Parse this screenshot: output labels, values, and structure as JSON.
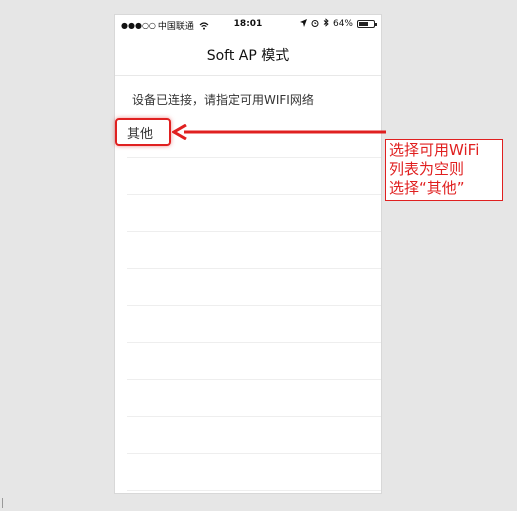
{
  "status_bar": {
    "signal_dots": "●●●○○",
    "carrier": "中国联通",
    "time": "18:01",
    "battery_percent": "64%",
    "battery_level": 0.64
  },
  "navbar": {
    "title": "Soft AP 模式"
  },
  "instruction": "设备已连接，请指定可用WIFI网络",
  "wifi_list": {
    "items": [
      "其他",
      "",
      "",
      "",
      "",
      "",
      "",
      "",
      "",
      ""
    ]
  },
  "annotation": {
    "lines": [
      "选择可用WiFi",
      "列表为空则",
      "选择“其他”"
    ],
    "color": "#e02020"
  },
  "icons": [
    "wifi-icon",
    "location-icon",
    "alarm-icon",
    "bluetooth-icon",
    "battery-icon"
  ]
}
